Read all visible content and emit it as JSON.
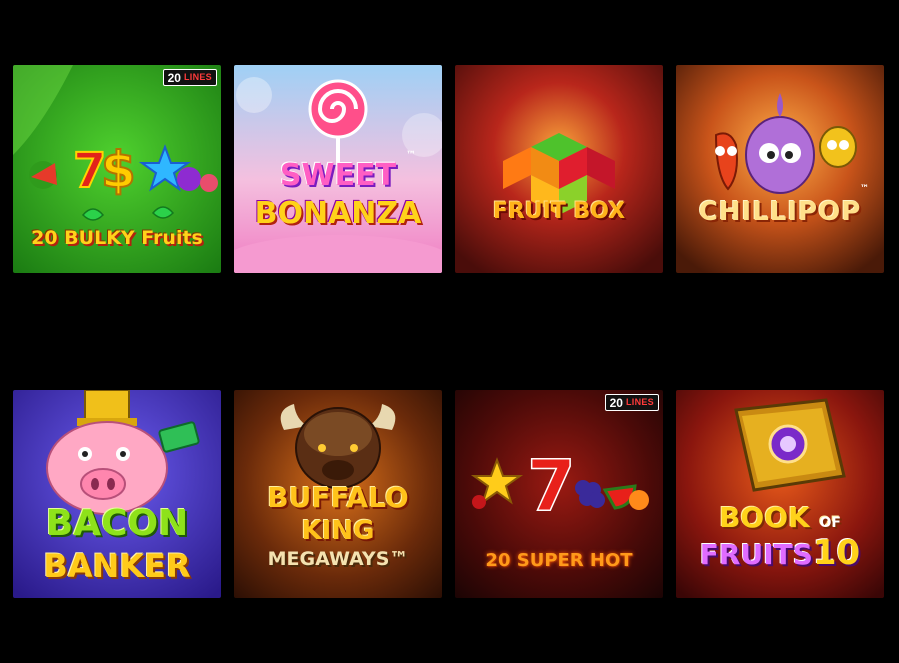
{
  "games": [
    {
      "title": "20 BULKY Fruits",
      "badge": {
        "number": "20",
        "word": "LINES"
      }
    },
    {
      "title_line1": "SWEET",
      "title_line2": "BONANZA",
      "trademark": "™"
    },
    {
      "title": "FRUIT BOX"
    },
    {
      "title": "CHILLIPOP",
      "trademark": "™"
    },
    {
      "title_line1": "BACON",
      "title_line2": "BANKER"
    },
    {
      "title_line1": "BUFFALO",
      "title_line2": "KING",
      "title_line3": "MEGAWAYS™"
    },
    {
      "title": "20 SUPER HOT",
      "badge": {
        "number": "20",
        "word": "LINES"
      }
    },
    {
      "title_line1": "BOOK",
      "title_of": "OF",
      "title_line2": "FRUITS",
      "title_num": "10"
    }
  ],
  "colors": {
    "page_background": "#000000",
    "badge_lines_red": "#ff3b3b"
  }
}
